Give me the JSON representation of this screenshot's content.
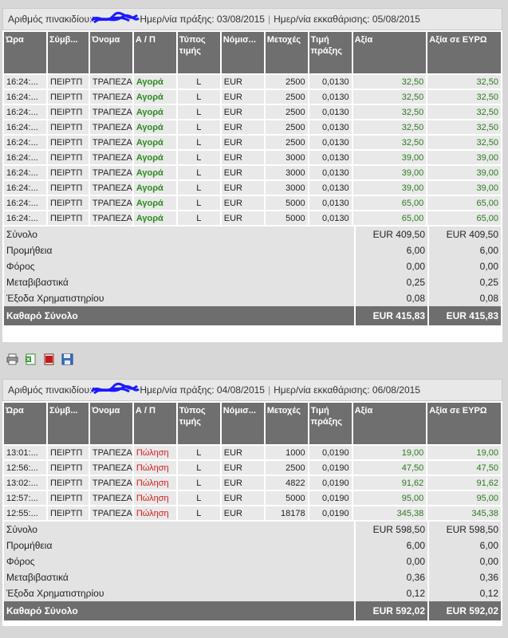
{
  "blocks": [
    {
      "header": {
        "slip_label": "Αριθμός πινακιδίου:",
        "trade_date_label": "Ημερ/νία πράξης: 03/08/2015",
        "settle_date_label": "Ημερ/νία εκκαθάρισης: 05/08/2015"
      },
      "rows": [
        [
          "16:24:...",
          "ΠΕΙΡΤΠ",
          "ΤΡΑΠΕΖΑ",
          "Αγορά",
          "L",
          "EUR",
          "2500",
          "0,0130",
          "32,50",
          "32,50"
        ],
        [
          "16:24:...",
          "ΠΕΙΡΤΠ",
          "ΤΡΑΠΕΖΑ",
          "Αγορά",
          "L",
          "EUR",
          "2500",
          "0,0130",
          "32,50",
          "32,50"
        ],
        [
          "16:24:...",
          "ΠΕΙΡΤΠ",
          "ΤΡΑΠΕΖΑ",
          "Αγορά",
          "L",
          "EUR",
          "2500",
          "0,0130",
          "32,50",
          "32,50"
        ],
        [
          "16:24:...",
          "ΠΕΙΡΤΠ",
          "ΤΡΑΠΕΖΑ",
          "Αγορά",
          "L",
          "EUR",
          "2500",
          "0,0130",
          "32,50",
          "32,50"
        ],
        [
          "16:24:...",
          "ΠΕΙΡΤΠ",
          "ΤΡΑΠΕΖΑ",
          "Αγορά",
          "L",
          "EUR",
          "2500",
          "0,0130",
          "32,50",
          "32,50"
        ],
        [
          "16:24:...",
          "ΠΕΙΡΤΠ",
          "ΤΡΑΠΕΖΑ",
          "Αγορά",
          "L",
          "EUR",
          "3000",
          "0,0130",
          "39,00",
          "39,00"
        ],
        [
          "16:24:...",
          "ΠΕΙΡΤΠ",
          "ΤΡΑΠΕΖΑ",
          "Αγορά",
          "L",
          "EUR",
          "3000",
          "0,0130",
          "39,00",
          "39,00"
        ],
        [
          "16:24:...",
          "ΠΕΙΡΤΠ",
          "ΤΡΑΠΕΖΑ",
          "Αγορά",
          "L",
          "EUR",
          "3000",
          "0,0130",
          "39,00",
          "39,00"
        ],
        [
          "16:24:...",
          "ΠΕΙΡΤΠ",
          "ΤΡΑΠΕΖΑ",
          "Αγορά",
          "L",
          "EUR",
          "5000",
          "0,0130",
          "65,00",
          "65,00"
        ],
        [
          "16:24:...",
          "ΠΕΙΡΤΠ",
          "ΤΡΑΠΕΖΑ",
          "Αγορά",
          "L",
          "EUR",
          "5000",
          "0,0130",
          "65,00",
          "65,00"
        ]
      ],
      "summary": [
        {
          "label": "Σύνολο",
          "value": "EUR 409,50",
          "value_eur": "EUR 409,50"
        },
        {
          "label": "Προμήθεια",
          "value": "6,00",
          "value_eur": "6,00"
        },
        {
          "label": "Φόρος",
          "value": "0,00",
          "value_eur": "0,00"
        },
        {
          "label": "Μεταβιβαστικά",
          "value": "0,25",
          "value_eur": "0,25"
        },
        {
          "label": "Έξοδα Χρηματιστηρίου",
          "value": "0,08",
          "value_eur": "0,08"
        }
      ],
      "net": {
        "label": "Καθαρό Σύνολο",
        "value": "EUR 415,83",
        "value_eur": "EUR 415,83"
      }
    },
    {
      "header": {
        "slip_label": "Αριθμός πινακιδίου:",
        "trade_date_label": "Ημερ/νία πράξης: 04/08/2015",
        "settle_date_label": "Ημερ/νία εκκαθάρισης: 06/08/2015"
      },
      "rows": [
        [
          "13:01:...",
          "ΠΕΙΡΤΠ",
          "ΤΡΑΠΕΖΑ",
          "Πώληση",
          "L",
          "EUR",
          "1000",
          "0,0190",
          "19,00",
          "19,00"
        ],
        [
          "12:56:...",
          "ΠΕΙΡΤΠ",
          "ΤΡΑΠΕΖΑ",
          "Πώληση",
          "L",
          "EUR",
          "2500",
          "0,0190",
          "47,50",
          "47,50"
        ],
        [
          "13:02:...",
          "ΠΕΙΡΤΠ",
          "ΤΡΑΠΕΖΑ",
          "Πώληση",
          "L",
          "EUR",
          "4822",
          "0,0190",
          "91,62",
          "91,62"
        ],
        [
          "12:57:...",
          "ΠΕΙΡΤΠ",
          "ΤΡΑΠΕΖΑ",
          "Πώληση",
          "L",
          "EUR",
          "5000",
          "0,0190",
          "95,00",
          "95,00"
        ],
        [
          "12:55:...",
          "ΠΕΙΡΤΠ",
          "ΤΡΑΠΕΖΑ",
          "Πώληση",
          "L",
          "EUR",
          "18178",
          "0,0190",
          "345,38",
          "345,38"
        ]
      ],
      "summary": [
        {
          "label": "Σύνολο",
          "value": "EUR 598,50",
          "value_eur": "EUR 598,50"
        },
        {
          "label": "Προμήθεια",
          "value": "6,00",
          "value_eur": "6,00"
        },
        {
          "label": "Φόρος",
          "value": "0,00",
          "value_eur": "0,00"
        },
        {
          "label": "Μεταβιβαστικά",
          "value": "0,36",
          "value_eur": "0,36"
        },
        {
          "label": "Έξοδα Χρηματιστηρίου",
          "value": "0,12",
          "value_eur": "0,12"
        }
      ],
      "net": {
        "label": "Καθαρό Σύνολο",
        "value": "EUR 592,02",
        "value_eur": "EUR 592,02"
      }
    }
  ],
  "columns": [
    "Ώρα",
    "Σύμβ...",
    "Όνομα",
    "Α / Π",
    "Τύπος τιμής",
    "Νόμισ...",
    "Μετοχές",
    "Τιμή πράξης",
    "Αξία",
    "Αξία σε ΕΥΡΩ"
  ],
  "toolbar": {
    "icons": [
      "printer-icon",
      "excel-icon",
      "pdf-icon",
      "save-icon"
    ]
  },
  "colors": {
    "buy": "#2c8a1f",
    "sell": "#d21b1b",
    "value": "#2c7a1f",
    "header_bg": "#6f6f6f"
  }
}
